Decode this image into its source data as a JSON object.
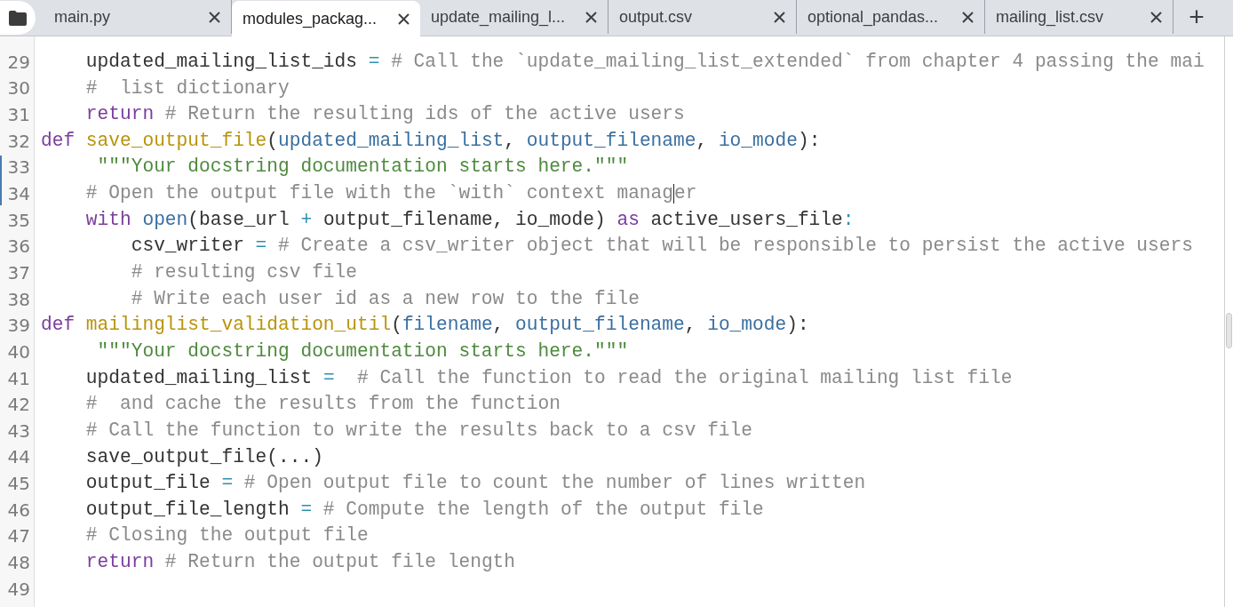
{
  "tabs": [
    {
      "label": "main.py",
      "selected": false
    },
    {
      "label": "modules_packag...",
      "selected": true
    },
    {
      "label": "update_mailing_l...",
      "selected": false
    },
    {
      "label": "output.csv",
      "selected": false
    },
    {
      "label": "optional_pandas...",
      "selected": false
    },
    {
      "label": "mailing_list.csv",
      "selected": false
    }
  ],
  "new_tab": "+",
  "editor": {
    "lines": [
      {
        "number": "29",
        "cursor": false,
        "tokens": [
          {
            "kind": "plain",
            "text": "    updated_mailing_list_ids "
          },
          {
            "kind": "op",
            "text": "="
          },
          {
            "kind": "comment",
            "text": " # Call the `update_mailing_list_extended` from chapter 4 passing the mai"
          }
        ]
      },
      {
        "number": "30",
        "cursor": false,
        "tokens": [
          {
            "kind": "comment",
            "text": "    #  list dictionary"
          }
        ]
      },
      {
        "number": "31",
        "cursor": false,
        "tokens": [
          {
            "kind": "keyword",
            "text": "    return"
          },
          {
            "kind": "comment",
            "text": " # Return the resulting ids of the active users"
          }
        ]
      },
      {
        "number": "32",
        "cursor": false,
        "tokens": [
          {
            "kind": "keyword",
            "text": "def "
          },
          {
            "kind": "function",
            "text": "save_output_file"
          },
          {
            "kind": "plain",
            "text": "("
          },
          {
            "kind": "param",
            "text": "updated_mailing_list"
          },
          {
            "kind": "plain",
            "text": ", "
          },
          {
            "kind": "param",
            "text": "output_filename"
          },
          {
            "kind": "plain",
            "text": ", "
          },
          {
            "kind": "param",
            "text": "io_mode"
          },
          {
            "kind": "plain",
            "text": "):"
          }
        ]
      },
      {
        "number": "33",
        "cursor": false,
        "tokens": [
          {
            "kind": "string",
            "text": "     \"\"\"Your docstring documentation starts here.\"\"\""
          }
        ]
      },
      {
        "number": "34",
        "cursor": true,
        "tokens": [
          {
            "kind": "comment",
            "text": "    # Open the output file with the `with` context manag"
          },
          {
            "kind": "comment",
            "text": "er"
          }
        ]
      },
      {
        "number": "35",
        "cursor": false,
        "tokens": [
          {
            "kind": "keyword",
            "text": "    with "
          },
          {
            "kind": "builtin",
            "text": "open"
          },
          {
            "kind": "plain",
            "text": "(base_url "
          },
          {
            "kind": "op",
            "text": "+"
          },
          {
            "kind": "plain",
            "text": " output_filename, io_mode) "
          },
          {
            "kind": "keyword",
            "text": "as"
          },
          {
            "kind": "plain",
            "text": " active_users_file"
          },
          {
            "kind": "op",
            "text": ":"
          }
        ]
      },
      {
        "number": "36",
        "cursor": false,
        "tokens": [
          {
            "kind": "plain",
            "text": "        csv_writer "
          },
          {
            "kind": "op",
            "text": "="
          },
          {
            "kind": "comment",
            "text": " # Create a csv_writer object that will be responsible to persist the active users"
          }
        ]
      },
      {
        "number": "37",
        "cursor": false,
        "tokens": [
          {
            "kind": "comment",
            "text": "        # resulting csv file"
          }
        ]
      },
      {
        "number": "38",
        "cursor": false,
        "tokens": [
          {
            "kind": "comment",
            "text": "        # Write each user id as a new row to the file"
          }
        ]
      },
      {
        "number": "39",
        "cursor": false,
        "tokens": [
          {
            "kind": "keyword",
            "text": "def "
          },
          {
            "kind": "function",
            "text": "mailinglist_validation_util"
          },
          {
            "kind": "plain",
            "text": "("
          },
          {
            "kind": "param",
            "text": "filename"
          },
          {
            "kind": "plain",
            "text": ", "
          },
          {
            "kind": "param",
            "text": "output_filename"
          },
          {
            "kind": "plain",
            "text": ", "
          },
          {
            "kind": "param",
            "text": "io_mode"
          },
          {
            "kind": "plain",
            "text": "):"
          }
        ]
      },
      {
        "number": "40",
        "cursor": false,
        "tokens": [
          {
            "kind": "string",
            "text": "     \"\"\"Your docstring documentation starts here.\"\"\""
          }
        ]
      },
      {
        "number": "41",
        "cursor": false,
        "tokens": [
          {
            "kind": "plain",
            "text": "    updated_mailing_list "
          },
          {
            "kind": "op",
            "text": "="
          },
          {
            "kind": "comment",
            "text": "  # Call the function to read the original mailing list file"
          }
        ]
      },
      {
        "number": "42",
        "cursor": false,
        "tokens": [
          {
            "kind": "comment",
            "text": "    #  and cache the results from the function"
          }
        ]
      },
      {
        "number": "43",
        "cursor": false,
        "tokens": [
          {
            "kind": "comment",
            "text": "    # Call the function to write the results back to a csv file"
          }
        ]
      },
      {
        "number": "44",
        "cursor": false,
        "tokens": [
          {
            "kind": "plain",
            "text": "    save_output_file(...)"
          }
        ]
      },
      {
        "number": "45",
        "cursor": false,
        "tokens": [
          {
            "kind": "plain",
            "text": "    output_file "
          },
          {
            "kind": "op",
            "text": "="
          },
          {
            "kind": "comment",
            "text": " # Open output file to count the number of lines written"
          }
        ]
      },
      {
        "number": "46",
        "cursor": false,
        "tokens": [
          {
            "kind": "plain",
            "text": "    output_file_length "
          },
          {
            "kind": "op",
            "text": "="
          },
          {
            "kind": "comment",
            "text": " # Compute the length of the output file"
          }
        ]
      },
      {
        "number": "47",
        "cursor": false,
        "tokens": [
          {
            "kind": "comment",
            "text": "    # Closing the output file"
          }
        ]
      },
      {
        "number": "48",
        "cursor": false,
        "tokens": [
          {
            "kind": "keyword",
            "text": "    return"
          },
          {
            "kind": "comment",
            "text": " # Return the output file length"
          }
        ]
      },
      {
        "number": "49",
        "cursor": false
      }
    ]
  }
}
